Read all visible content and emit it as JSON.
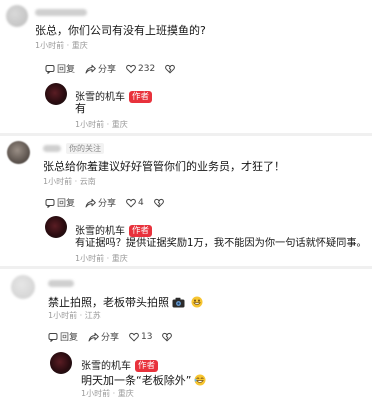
{
  "comments": [
    {
      "text": "张总，你们公司有没有上班摸鱼的?",
      "time": "1小时前",
      "location": "重庆",
      "actions": {
        "reply": "回复",
        "share": "分享",
        "likes": "232"
      },
      "reply": {
        "name": "张雪的机车",
        "tag": "作者",
        "text": "有",
        "time": "1小时前",
        "location": "重庆"
      }
    },
    {
      "badge": "你的关注",
      "text": "张总给你羞建议好好管管你们的业务员，才狂了！",
      "time": "1小时前",
      "location": "云南",
      "actions": {
        "reply": "回复",
        "share": "分享",
        "likes": "4"
      },
      "reply": {
        "name": "张雪的机车",
        "tag": "作者",
        "text": "有证据吗？提供证据奖励1万，我不能因为你一句话就怀疑同事。",
        "time": "1小时前",
        "location": "重庆"
      }
    },
    {
      "text": "禁止拍照，老板带头拍照",
      "time": "1小时前",
      "location": "江苏",
      "actions": {
        "reply": "回复",
        "share": "分享",
        "likes": "13"
      },
      "reply": {
        "name": "张雪的机车",
        "tag": "作者",
        "text": "明天加一条“老板除外”",
        "time": "1小时前",
        "location": "重庆"
      }
    }
  ],
  "colors": {
    "author_tag": "#e8323c",
    "meta": "#9a9a9a"
  },
  "icons": [
    "reply-icon",
    "share-icon",
    "heart-icon",
    "dislike-icon",
    "emoji-icon"
  ]
}
